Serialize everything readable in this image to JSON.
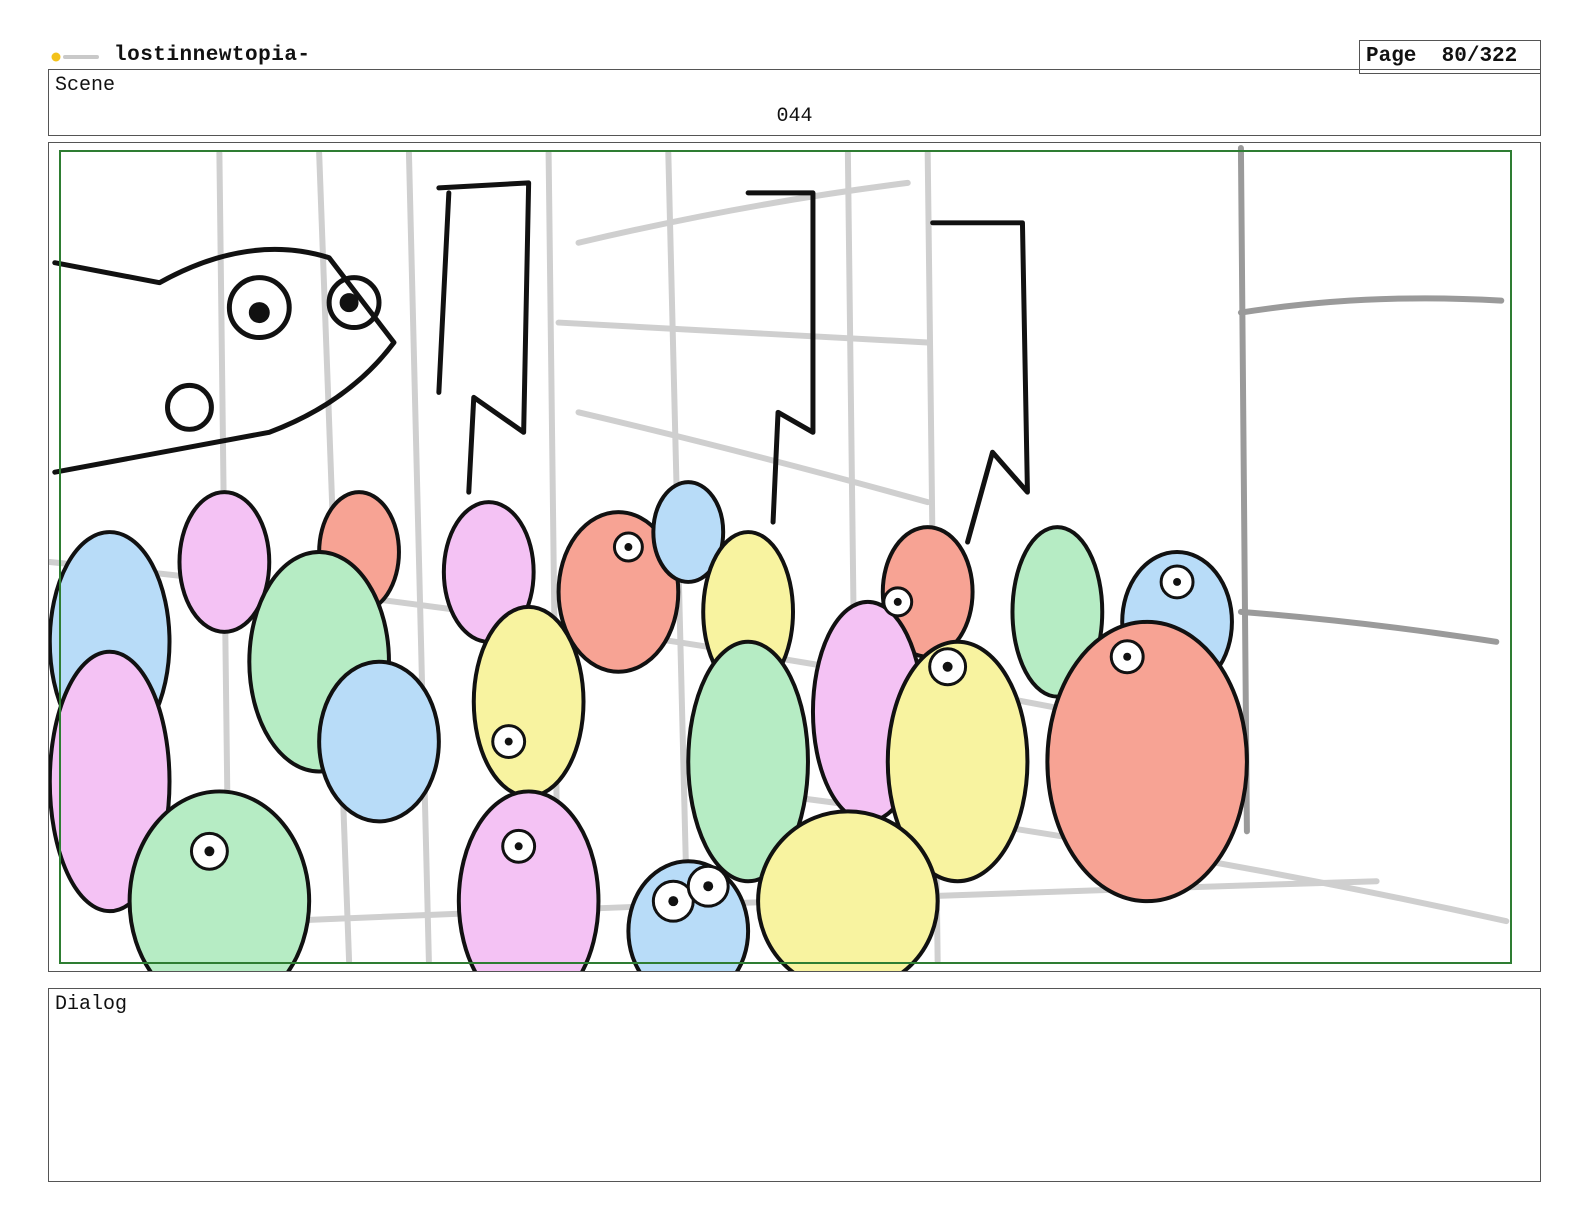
{
  "header": {
    "project_title": "lostinnewtopia-",
    "page_label": "Page",
    "page_number": "80/322"
  },
  "scene": {
    "label": "Scene",
    "number": "044"
  },
  "dialog": {
    "label": "Dialog",
    "text": ""
  },
  "colors": {
    "frame_green": "#2e7d32",
    "lizard_pink": "#f4c2f4",
    "lizard_green": "#b6ecc4",
    "lizard_blue": "#b8dcf8",
    "lizard_yellow": "#f8f3a0",
    "lizard_red": "#f7a394"
  },
  "icons": {
    "logo": "toon-boom-logo"
  }
}
